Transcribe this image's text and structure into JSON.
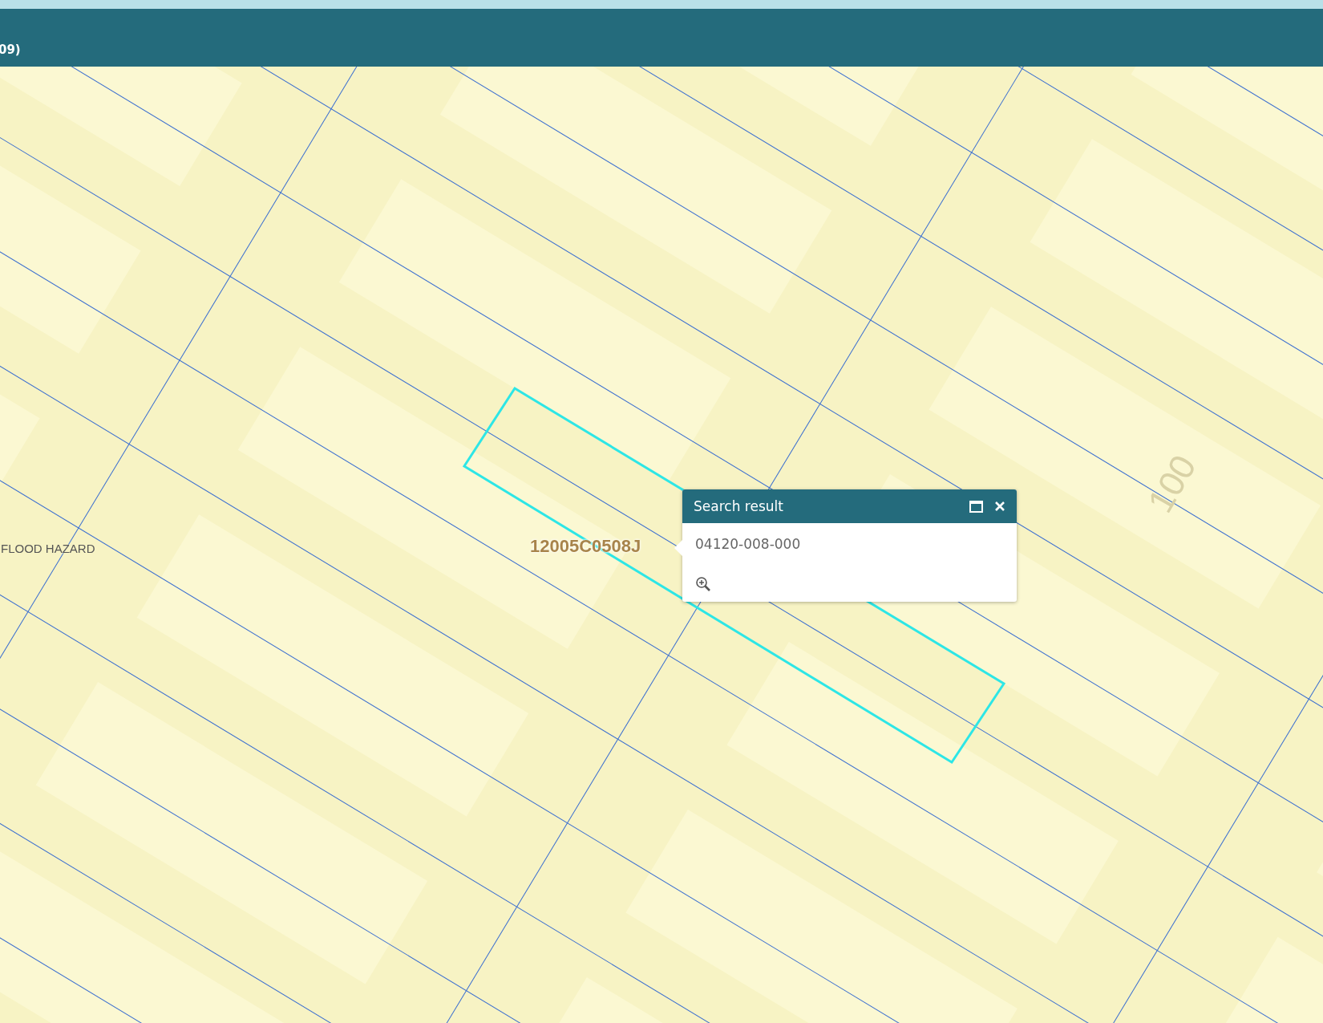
{
  "header": {
    "title": "09)"
  },
  "map": {
    "labels": [
      {
        "kind": "zone",
        "text": "FLOOD HAZARD"
      },
      {
        "kind": "panel",
        "text": "12005C0508J"
      },
      {
        "kind": "road",
        "text": "100"
      }
    ]
  },
  "popup": {
    "title": "Search result",
    "value": "04120-008-000"
  }
}
